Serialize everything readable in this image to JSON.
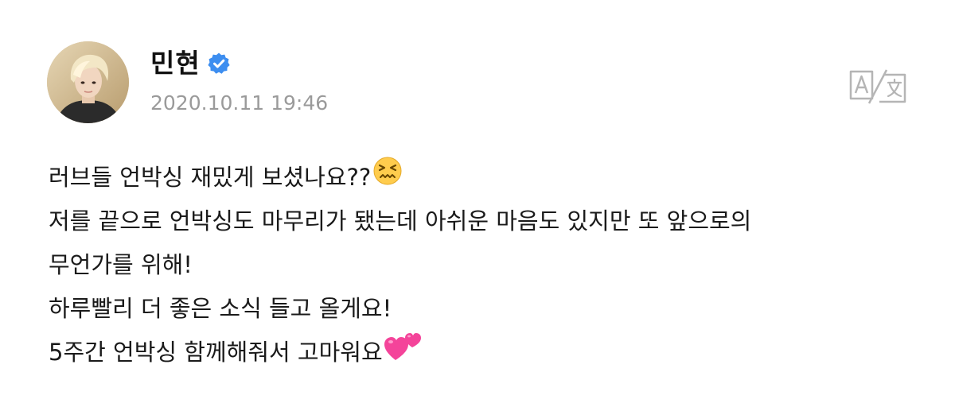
{
  "post": {
    "author_name": "민현",
    "verified_icon": "verified-badge-icon",
    "timestamp": "2020.10.11 19:46",
    "translate_icon": "translate-icon",
    "lines": [
      "러브들 언박싱 재밌게 보셨나요??",
      "저를 끝으로 언박싱도 마무리가 됐는데 아쉬운 마음도 있지만 또 앞으로의",
      "무언가를 위해!",
      "하루빨리 더 좋은 소식 들고 올게요!",
      "5주간 언박싱 함께해줘서 고마워요"
    ],
    "emojis": {
      "line_1": "confounded-face-emoji",
      "line_5": "two-hearts-emoji"
    }
  },
  "colors": {
    "verified_blue": "#3d8ef0",
    "timestamp_gray": "#9a9a9a",
    "icon_gray": "#b5b5b5"
  }
}
